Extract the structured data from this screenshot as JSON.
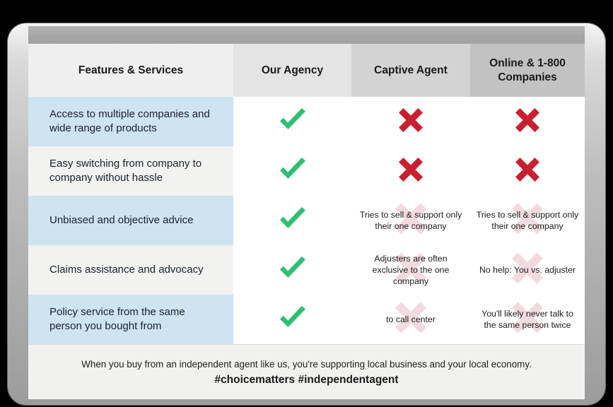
{
  "colors": {
    "check_green": "#2FBF71",
    "x_red": "#C8202F",
    "x_faded_pink": "#F3DADE",
    "row_blue": "#CFE4F1",
    "row_gray": "#F2F2F0",
    "header_col1": "#EFEFEF",
    "header_col2": "#E4E4E4",
    "header_col3": "#D3D3D3",
    "header_col4": "#C2C2C2",
    "bezel_gray": "#A6A6A6"
  },
  "table": {
    "headers": [
      {
        "label": "Features & Services"
      },
      {
        "label": "Our Agency"
      },
      {
        "label": "Captive Agent"
      },
      {
        "label": "Online & 1-800 Companies"
      }
    ],
    "rows": [
      {
        "feature": "Access to multiple companies and wide range of products",
        "ours": {
          "icon": "check-icon",
          "note": ""
        },
        "captive": {
          "icon": "x-icon",
          "note": ""
        },
        "online": {
          "icon": "x-icon",
          "note": ""
        }
      },
      {
        "feature": "Easy switching from company to company without hassle",
        "ours": {
          "icon": "check-icon",
          "note": ""
        },
        "captive": {
          "icon": "x-icon",
          "note": ""
        },
        "online": {
          "icon": "x-icon",
          "note": ""
        }
      },
      {
        "feature": "Unbiased and objective advice",
        "ours": {
          "icon": "check-icon",
          "note": ""
        },
        "captive": {
          "icon": "x-faded-icon",
          "note": "Tries to sell & support only their one company"
        },
        "online": {
          "icon": "x-faded-icon",
          "note": "Tries to sell & support only their one company"
        }
      },
      {
        "feature": "Claims assistance and advocacy",
        "ours": {
          "icon": "check-icon",
          "note": ""
        },
        "captive": {
          "icon": "x-faded-icon",
          "note": "Adjusters are often exclusive to the one company"
        },
        "online": {
          "icon": "x-faded-icon",
          "note": "No help: You vs. adjuster"
        }
      },
      {
        "feature": "Policy service from the same person you bought from",
        "ours": {
          "icon": "check-icon",
          "note": ""
        },
        "captive": {
          "icon": "x-faded-icon",
          "note": "to call center"
        },
        "online": {
          "icon": "x-faded-icon",
          "note": "You'll likely never talk to the same person twice"
        }
      }
    ]
  },
  "footer": {
    "line1": "When you buy from an independent agent like us, you're supporting local business and your local economy.",
    "line2": "#choicematters #independentagent"
  }
}
